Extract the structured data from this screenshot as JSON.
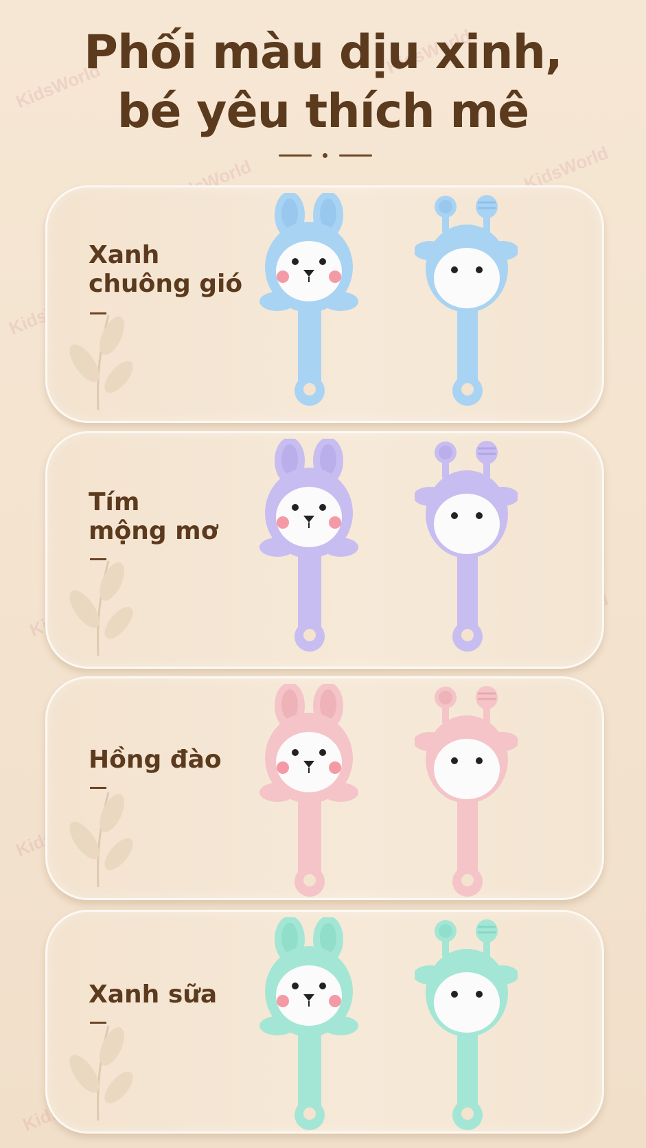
{
  "headline": {
    "line1": "Phối màu dịu xinh,",
    "line2": "bé yêu thích mê"
  },
  "watermark_text": "KidsWorld",
  "variants": [
    {
      "name_line1": "Xanh",
      "name_line2": "chuông gió",
      "color": "#a9d3f3",
      "shade": "#8fc1eb"
    },
    {
      "name_line1": "Tím",
      "name_line2": "mộng mơ",
      "color": "#c7bdf0",
      "shade": "#b1a5e6"
    },
    {
      "name_line1": "Hồng đào",
      "name_line2": "",
      "color": "#f4c4c8",
      "shade": "#eaa8ae"
    },
    {
      "name_line1": "Xanh sữa",
      "name_line2": "",
      "color": "#a4e6d5",
      "shade": "#85d8c3"
    }
  ],
  "colors": {
    "background": "#f5e6d3",
    "heading_brown": "#5b3a1e",
    "cheek_pink": "#f49aa6"
  },
  "icons": [
    "bunny-teether-icon",
    "giraffe-teether-icon",
    "leaf-decoration-icon",
    "watermark-logo"
  ]
}
